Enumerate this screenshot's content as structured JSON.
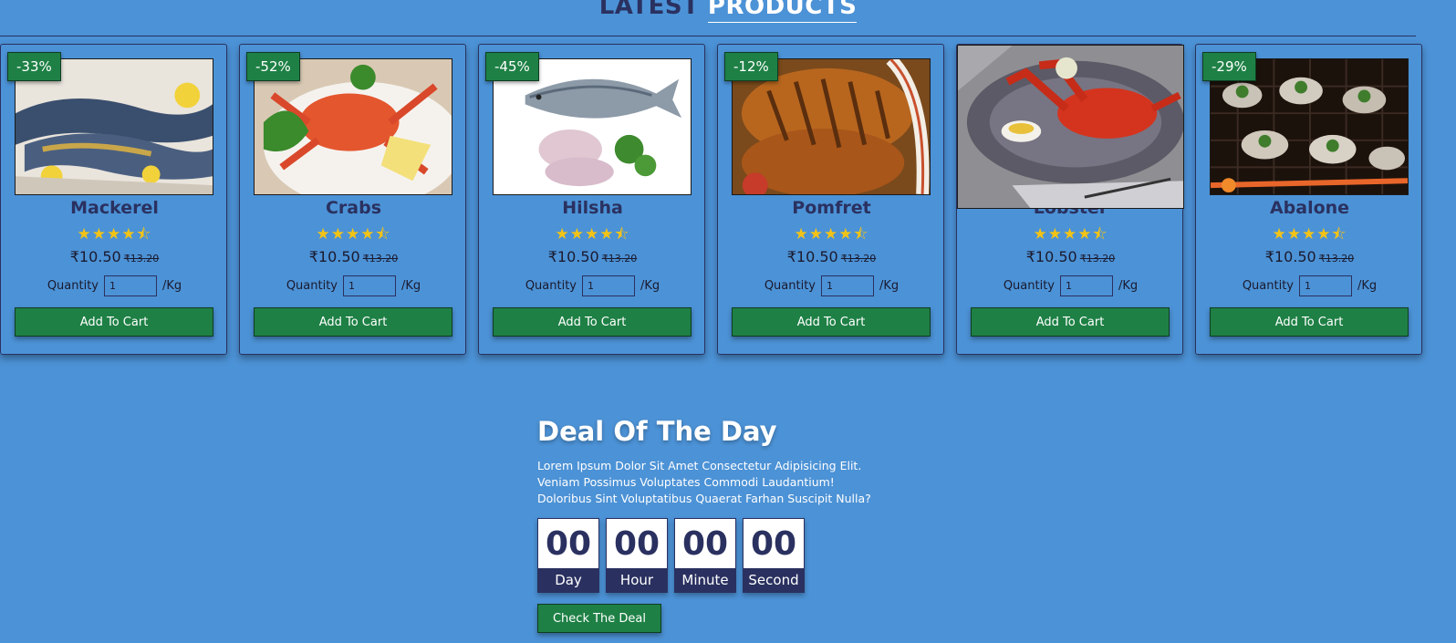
{
  "section": {
    "title_dark": "LATEST",
    "title_light": "PRODUCTS"
  },
  "colors": {
    "background": "#4c92d6",
    "accent_green": "#1e8045",
    "navy": "#2a3160",
    "star": "#f3c316"
  },
  "products": [
    {
      "discount": "-33%",
      "name": "Mackerel",
      "rating": 4.5,
      "stars": "★★★★⯪",
      "price": "₹10.50",
      "old_price": "₹13.20",
      "quantity_label": "Quantity",
      "quantity": "1",
      "unit": "/Kg",
      "button": "Add To Cart",
      "image": "mackerel-fish-image"
    },
    {
      "discount": "-52%",
      "name": "Crabs",
      "rating": 4.5,
      "stars": "★★★★⯪",
      "price": "₹10.50",
      "old_price": "₹13.20",
      "quantity_label": "Quantity",
      "quantity": "1",
      "unit": "/Kg",
      "button": "Add To Cart",
      "image": "crab-plate-image"
    },
    {
      "discount": "-45%",
      "name": "Hilsha",
      "rating": 4.5,
      "stars": "★★★★⯪",
      "price": "₹10.50",
      "old_price": "₹13.20",
      "quantity_label": "Quantity",
      "quantity": "1",
      "unit": "/Kg",
      "button": "Add To Cart",
      "image": "hilsha-fish-image"
    },
    {
      "discount": "-12%",
      "name": "Pomfret",
      "rating": 4.5,
      "stars": "★★★★⯪",
      "price": "₹10.50",
      "old_price": "₹13.20",
      "quantity_label": "Quantity",
      "quantity": "1",
      "unit": "/Kg",
      "button": "Add To Cart",
      "image": "grilled-pomfret-image"
    },
    {
      "discount": "",
      "name": "Lobster",
      "rating": 4.5,
      "stars": "★★★★⯪",
      "price": "₹10.50",
      "old_price": "₹13.20",
      "quantity_label": "Quantity",
      "quantity": "1",
      "unit": "/Kg",
      "button": "Add To Cart",
      "image": "lobster-plate-image"
    },
    {
      "discount": "-29%",
      "name": "Abalone",
      "rating": 4.5,
      "stars": "★★★★⯪",
      "price": "₹10.50",
      "old_price": "₹13.20",
      "quantity_label": "Quantity",
      "quantity": "1",
      "unit": "/Kg",
      "button": "Add To Cart",
      "image": "grilled-abalone-image"
    }
  ],
  "deal": {
    "title": "Deal Of The Day",
    "text": "Lorem Ipsum Dolor Sit Amet Consectetur Adipisicing Elit. Veniam Possimus Voluptates Commodi Laudantium! Doloribus Sint Voluptatibus Quaerat Farhan Suscipit Nulla?",
    "timer": [
      {
        "value": "00",
        "label": "Day"
      },
      {
        "value": "00",
        "label": "Hour"
      },
      {
        "value": "00",
        "label": "Minute"
      },
      {
        "value": "00",
        "label": "Second"
      }
    ],
    "button": "Check The Deal"
  }
}
